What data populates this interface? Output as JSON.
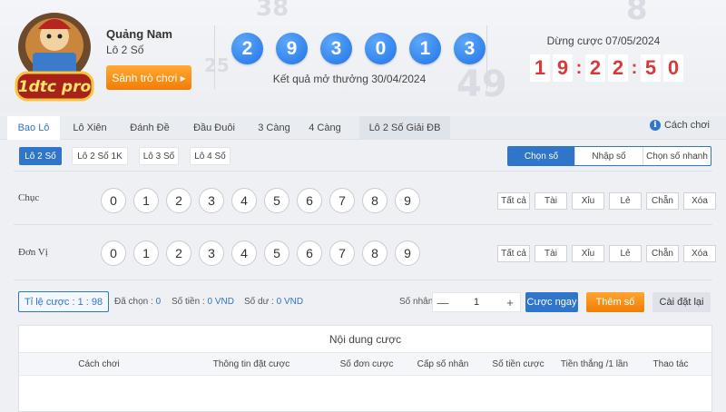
{
  "header": {
    "game_name": "Quảng Nam",
    "game_type": "Lô 2 Số",
    "lobby_button": "Sảnh trò chơi ▸",
    "logo_text": "1dtc pro",
    "result_numbers": [
      "2",
      "9",
      "3",
      "0",
      "1",
      "3"
    ],
    "result_label": "Kết quả mở thưởng 30/04/2024",
    "stop_label": "Dừng cược 07/05/2024",
    "countdown": [
      "1",
      "9",
      "2",
      "2",
      "5",
      "0"
    ],
    "ball_color": "#2f80ed",
    "countdown_color": "#d63a3a"
  },
  "tabs": {
    "items": [
      "Bao Lô",
      "Lô Xiên",
      "Đánh Đề",
      "Đầu Đuôi",
      "3 Càng",
      "4 Càng",
      "Lô 2 Số Giải ĐB"
    ],
    "active": "Bao Lô",
    "how_to_play": "Cách chơi"
  },
  "sub_options": {
    "items": [
      "Lô 2 Số",
      "Lô 2 Số 1K",
      "Lô 3 Số",
      "Lô 4 Số"
    ],
    "active": "Lô 2 Số"
  },
  "modes": {
    "items": [
      "Chọn số",
      "Nhập số",
      "Chọn số nhanh"
    ],
    "active": "Chọn số"
  },
  "rows": [
    {
      "label": "Chục",
      "numbers": [
        "0",
        "1",
        "2",
        "3",
        "4",
        "5",
        "6",
        "7",
        "8",
        "9"
      ],
      "quick": [
        "Tất cả",
        "Tài",
        "Xỉu",
        "Lẻ",
        "Chẵn",
        "Xóa"
      ]
    },
    {
      "label": "Đơn Vị",
      "numbers": [
        "0",
        "1",
        "2",
        "3",
        "4",
        "5",
        "6",
        "7",
        "8",
        "9"
      ],
      "quick": [
        "Tất cả",
        "Tài",
        "Xỉu",
        "Lẻ",
        "Chẵn",
        "Xóa"
      ]
    }
  ],
  "bet_bar": {
    "rate_label": "Tỉ lệ cược : 1 : 98",
    "selected_label": "Đã chọn :",
    "selected_value": "0",
    "amount_label": "Số tiền :",
    "amount_value": "0 VND",
    "balance_label": "Số dư :",
    "balance_value": "0 VND",
    "multiplier_label": "Số nhân :",
    "multiplier_minus": "—",
    "multiplier_value": "1",
    "multiplier_plus": "+",
    "bet_now": "Cược ngay",
    "add_number": "Thêm số",
    "reset": "Cài đặt lại"
  },
  "bet_table": {
    "title": "Nội dung cược",
    "columns": [
      "Cách chơi",
      "Thông tin đặt cược",
      "Số đơn cược",
      "Cấp số nhân",
      "Số tiền cược",
      "Tiền thắng /1 lần",
      "Thao tác"
    ]
  },
  "background_numbers": [
    "38",
    "49",
    "25",
    "8"
  ]
}
